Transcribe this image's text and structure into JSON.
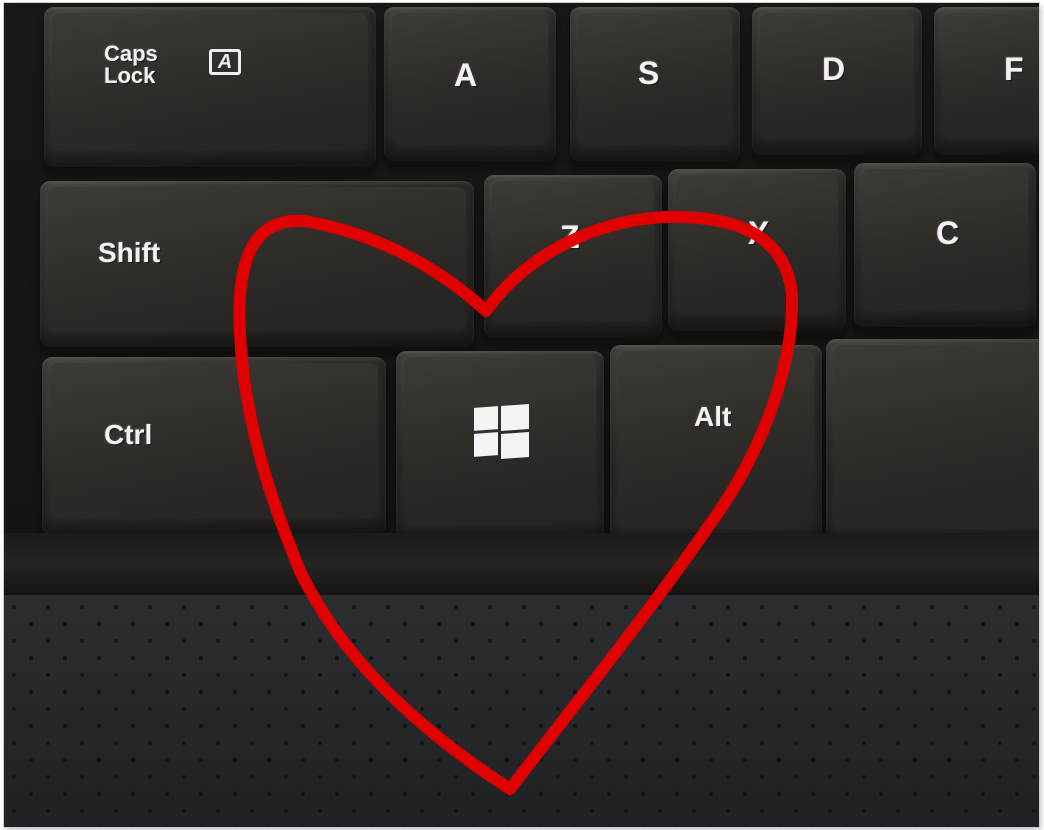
{
  "keys": {
    "caps_lock": "Caps\nLock",
    "caps_lock_indicator": "A",
    "a": "A",
    "s": "S",
    "d": "D",
    "f": "F",
    "shift": "Shift",
    "z": "Z",
    "x": "X",
    "c": "C",
    "ctrl": "Ctrl",
    "alt": "Alt"
  },
  "colors": {
    "key": "#2d2a27",
    "legend": "#f2f2f2",
    "heart_stroke": "#e00000",
    "palm_rest": "#26282c"
  },
  "icons": {
    "windows": "windows-logo-icon",
    "heart": "heart-drawing"
  }
}
